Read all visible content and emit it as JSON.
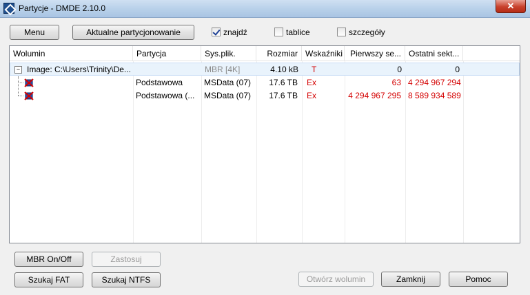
{
  "window": {
    "title": "Partycje - DMDE 2.10.0",
    "close_glyph": "✕"
  },
  "toolbar": {
    "menu_label": "Menu",
    "current_partitioning_label": "Aktualne partycjonowanie",
    "checkboxes": [
      {
        "label": "znajdź",
        "checked": true
      },
      {
        "label": "tablice",
        "checked": false
      },
      {
        "label": "szczegóły",
        "checked": false
      }
    ]
  },
  "table": {
    "columns": [
      "Wolumin",
      "Partycja",
      "Sys.plik.",
      "Rozmiar",
      "Wskaźniki",
      "Pierwszy se...",
      "Ostatni sekt..."
    ],
    "rows": [
      {
        "volume": "Image: C:\\Users\\Trinity\\De...",
        "partition": "",
        "fs": "MBR [4K]",
        "size": "4.10 kB",
        "flags": "T",
        "first": "0",
        "last": "0",
        "icon": "disk-icon",
        "expander": "−"
      },
      {
        "volume": "",
        "partition": "Podstawowa",
        "fs": "MSData (07)",
        "size": "17.6 TB",
        "flags": "Ex",
        "first": "63",
        "last": "4 294 967 294",
        "icon": "partition-error-icon"
      },
      {
        "volume": "",
        "partition": "Podstawowa (...",
        "fs": "MSData (07)",
        "size": "17.6 TB",
        "flags": "Ex",
        "first": "4 294 967 295",
        "last": "8 589 934 589",
        "icon": "partition-error-icon"
      }
    ]
  },
  "bottom": {
    "mbr_onoff_label": "MBR On/Off",
    "apply_label": "Zastosuj",
    "search_fat_label": "Szukaj FAT",
    "search_ntfs_label": "Szukaj NTFS",
    "open_volume_label": "Otwórz wolumin",
    "close_label": "Zamknij",
    "help_label": "Pomoc"
  }
}
